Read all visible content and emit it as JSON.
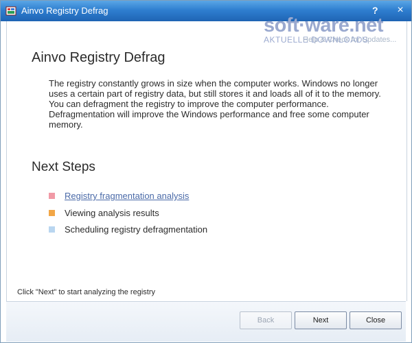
{
  "window": {
    "title": "Ainvo Registry Defrag",
    "help_glyph": "?",
    "close_glyph": "×"
  },
  "watermark": {
    "brand": "soft·ware.net",
    "subtitle": "AKTUELLE DOWNLOADS",
    "help_link": "Help & Check for Updates..."
  },
  "main": {
    "title": "Ainvo Registry Defrag",
    "description": "The registry constantly grows in size when the computer works. Windows no longer uses a certain part of registry data, but still stores it and loads all of it to the memory. You can defragment the registry to improve the computer performance. Defragmentation will improve the Windows performance and free some computer memory.",
    "next_steps_title": "Next Steps",
    "steps": [
      {
        "label": "Registry fragmentation analysis",
        "color": "#f19aa6"
      },
      {
        "label": "Viewing analysis results",
        "color": "#f2a646"
      },
      {
        "label": "Scheduling registry defragmentation",
        "color": "#b9d6f0"
      }
    ],
    "hint": "Click \"Next\" to start analyzing the registry"
  },
  "footer": {
    "back": "Back",
    "next": "Next",
    "close": "Close"
  },
  "colors": {
    "titlebar": "#2f7fd0",
    "link": "#4a6aa8"
  }
}
